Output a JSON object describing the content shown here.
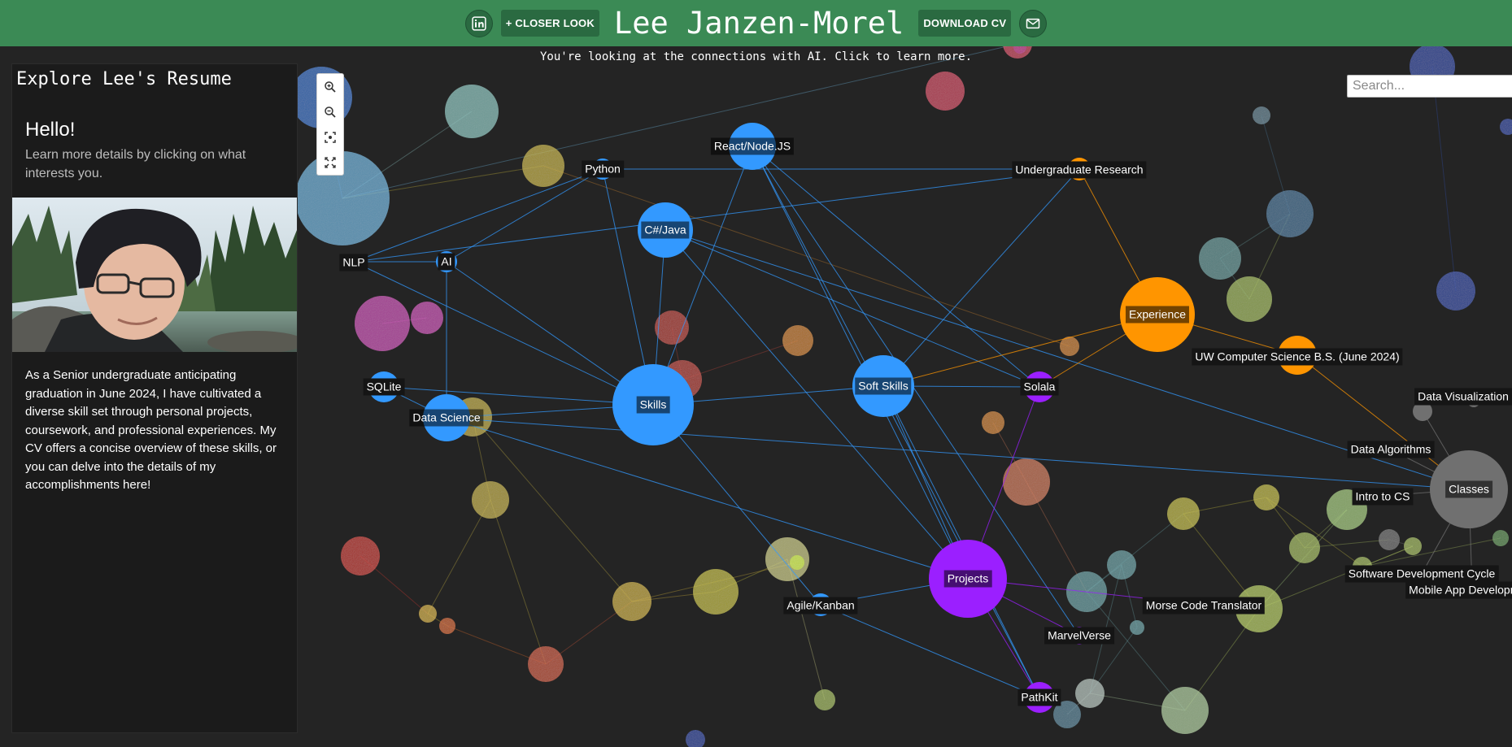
{
  "header": {
    "title": "Lee Janzen-Morel",
    "closer_look_label": "+ CLOSER LOOK",
    "download_cv_label": "DOWNLOAD CV",
    "linkedin_icon": "linkedin-icon",
    "email_icon": "mail-icon"
  },
  "hint": "You're looking at the connections with AI. Click to learn more.",
  "panel": {
    "title": "Explore Lee's Resume",
    "hello": "Hello!",
    "hello_sub": "Learn more details by clicking on what interests you.",
    "bio": "As a Senior undergraduate anticipating graduation in June 2024, I have cultivated a diverse skill set through personal projects, coursework, and professional experiences. My CV offers a concise overview of these skills, or you can delve into the details of my accomplishments here!"
  },
  "search": {
    "placeholder": "Search..."
  },
  "zoom_icons": [
    "zoom-in-icon",
    "zoom-out-icon",
    "fit-view-icon",
    "fullscreen-icon"
  ],
  "colors": {
    "header": "#3b8a55",
    "skills": "#3399ff",
    "experience": "#ff9500",
    "projects": "#9b1fff",
    "classes": "#707070",
    "background": "#242424"
  },
  "graph": {
    "nodes": [
      {
        "id": "skills",
        "label": "Skills",
        "group": "skills"
      },
      {
        "id": "softskills",
        "label": "Soft Skills",
        "group": "skills"
      },
      {
        "id": "react",
        "label": "React/Node.JS",
        "group": "skills"
      },
      {
        "id": "csharp",
        "label": "C#/Java",
        "group": "skills"
      },
      {
        "id": "python",
        "label": "Python",
        "group": "skills"
      },
      {
        "id": "ai",
        "label": "AI",
        "group": "skills"
      },
      {
        "id": "nlp",
        "label": "NLP",
        "group": "skills"
      },
      {
        "id": "sqlite",
        "label": "SQLite",
        "group": "skills"
      },
      {
        "id": "datasci",
        "label": "Data Science",
        "group": "skills"
      },
      {
        "id": "agile",
        "label": "Agile/Kanban",
        "group": "skills"
      },
      {
        "id": "experience",
        "label": "Experience",
        "group": "experience"
      },
      {
        "id": "ugresearch",
        "label": "Undergraduate Research",
        "group": "experience"
      },
      {
        "id": "uwcs",
        "label": "UW Computer Science B.S. (June 2024)",
        "group": "experience"
      },
      {
        "id": "projects",
        "label": "Projects",
        "group": "projects"
      },
      {
        "id": "solala",
        "label": "Solala",
        "group": "projects"
      },
      {
        "id": "pathkit",
        "label": "PathKit",
        "group": "projects"
      },
      {
        "id": "marvel",
        "label": "MarvelVerse",
        "group": "projects"
      },
      {
        "id": "morse",
        "label": "Morse Code Translator",
        "group": "projects"
      },
      {
        "id": "classes",
        "label": "Classes",
        "group": "classes"
      },
      {
        "id": "datavis",
        "label": "Data Visualization",
        "group": "classes"
      },
      {
        "id": "dataalg",
        "label": "Data Algorithms",
        "group": "classes"
      },
      {
        "id": "introcs",
        "label": "Intro to CS",
        "group": "classes"
      },
      {
        "id": "sdc",
        "label": "Software Development Cycle",
        "group": "classes"
      },
      {
        "id": "mobile",
        "label": "Mobile App Development",
        "group": "classes"
      }
    ],
    "links": [
      [
        "skills",
        "softskills"
      ],
      [
        "skills",
        "react"
      ],
      [
        "skills",
        "csharp"
      ],
      [
        "skills",
        "python"
      ],
      [
        "skills",
        "ai"
      ],
      [
        "skills",
        "sqlite"
      ],
      [
        "skills",
        "datasci"
      ],
      [
        "skills",
        "agile"
      ],
      [
        "skills",
        "nlp"
      ],
      [
        "softskills",
        "ugresearch"
      ],
      [
        "softskills",
        "solala"
      ],
      [
        "softskills",
        "projects"
      ],
      [
        "softskills",
        "pathkit"
      ],
      [
        "nlp",
        "ai"
      ],
      [
        "nlp",
        "python"
      ],
      [
        "nlp",
        "ugresearch"
      ],
      [
        "ai",
        "datasci"
      ],
      [
        "ai",
        "python"
      ],
      [
        "python",
        "ugresearch"
      ],
      [
        "react",
        "solala"
      ],
      [
        "react",
        "projects"
      ],
      [
        "react",
        "pathkit"
      ],
      [
        "react",
        "marvel"
      ],
      [
        "csharp",
        "classes"
      ],
      [
        "csharp",
        "solala"
      ],
      [
        "csharp",
        "projects"
      ],
      [
        "datasci",
        "projects"
      ],
      [
        "datasci",
        "classes"
      ],
      [
        "agile",
        "projects"
      ],
      [
        "agile",
        "pathkit"
      ],
      [
        "projects",
        "solala"
      ],
      [
        "projects",
        "pathkit"
      ],
      [
        "projects",
        "marvel"
      ],
      [
        "projects",
        "morse"
      ],
      [
        "experience",
        "ugresearch"
      ],
      [
        "experience",
        "uwcs"
      ],
      [
        "experience",
        "solala"
      ],
      [
        "experience",
        "softskills"
      ],
      [
        "uwcs",
        "classes"
      ],
      [
        "classes",
        "datavis"
      ],
      [
        "classes",
        "dataalg"
      ],
      [
        "classes",
        "introcs"
      ],
      [
        "classes",
        "sdc"
      ],
      [
        "classes",
        "mobile"
      ],
      [
        "sqlite",
        "datasci"
      ]
    ]
  }
}
